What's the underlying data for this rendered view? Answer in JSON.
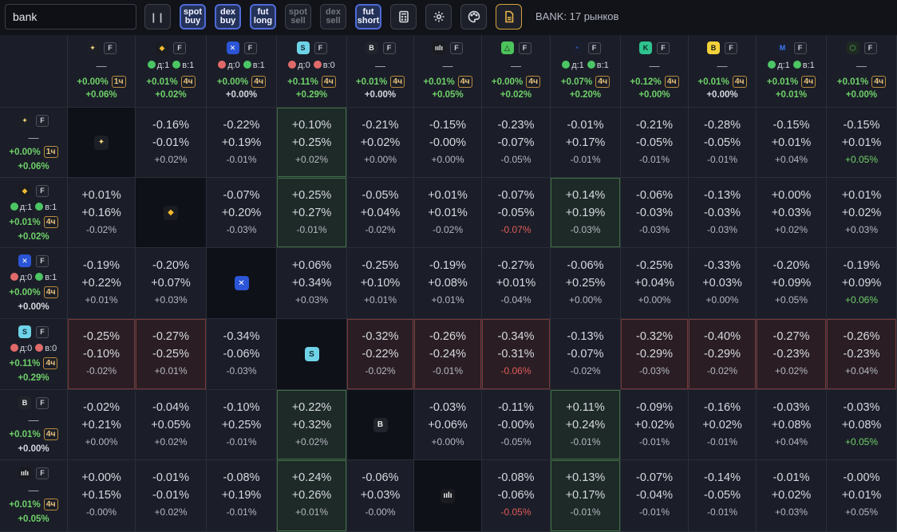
{
  "search": {
    "value": "bank"
  },
  "toolbar": {
    "pause_label": "| |",
    "buttons": [
      {
        "l1": "spot",
        "l2": "buy",
        "state": "on"
      },
      {
        "l1": "dex",
        "l2": "buy",
        "state": "on"
      },
      {
        "l1": "fut",
        "l2": "long",
        "state": "on"
      },
      {
        "l1": "spot",
        "l2": "sell",
        "state": "off"
      },
      {
        "l1": "dex",
        "l2": "sell",
        "state": "off"
      },
      {
        "l1": "fut",
        "l2": "short",
        "state": "on"
      }
    ],
    "icons": [
      "calculator-icon",
      "gear-icon",
      "palette-icon",
      "document-icon"
    ]
  },
  "status": "BANK: 17 рынков",
  "fut_badge": "F",
  "exchanges": [
    {
      "id": "gate",
      "bg": "#1d1f26",
      "fg": "#f0d27a",
      "glyph": "✦",
      "mid": "dash",
      "d": "",
      "w": "",
      "p1": "+0.00%",
      "tf": "1ч",
      "p2": "+0.06%",
      "p2n": false
    },
    {
      "id": "binance",
      "bg": "#1b1c22",
      "fg": "#f3ba2f",
      "glyph": "◆",
      "mid": "dw",
      "d": "д:1",
      "dc": "g",
      "w": "в:1",
      "wc": "g",
      "p1": "+0.01%",
      "tf": "4ч",
      "p2": "+0.02%",
      "p2n": false
    },
    {
      "id": "mexc",
      "bg": "#2b55d6",
      "fg": "#ffffff",
      "glyph": "✕",
      "mid": "dw",
      "d": "д:0",
      "dc": "r",
      "w": "в:1",
      "wc": "g",
      "p1": "+0.00%",
      "tf": "4ч",
      "p2": "+0.00%",
      "p2n": true
    },
    {
      "id": "bybit",
      "bg": "#6fd3e8",
      "fg": "#0f2a33",
      "glyph": "S",
      "mid": "dw",
      "d": "д:0",
      "dc": "r",
      "w": "в:0",
      "wc": "r",
      "p1": "+0.11%",
      "tf": "4ч",
      "p2": "+0.29%",
      "p2n": false
    },
    {
      "id": "bitget",
      "bg": "#22242c",
      "fg": "#e8e8e8",
      "glyph": "B",
      "mid": "dash",
      "d": "",
      "w": "",
      "p1": "+0.01%",
      "tf": "4ч",
      "p2": "+0.00%",
      "p2n": true
    },
    {
      "id": "kucoin",
      "bg": "#1a1b20",
      "fg": "#f2f2f2",
      "glyph": "ıılı",
      "mid": "dash",
      "d": "",
      "w": "",
      "p1": "+0.01%",
      "tf": "4ч",
      "p2": "+0.05%",
      "p2n": false
    },
    {
      "id": "okx",
      "bg": "#4cc35b",
      "fg": "#0d1a0f",
      "glyph": "△",
      "mid": "dash",
      "d": "",
      "w": "",
      "p1": "+0.00%",
      "tf": "4ч",
      "p2": "+0.02%",
      "p2n": false
    },
    {
      "id": "htx",
      "bg": "#1a1e2d",
      "fg": "#3a6df0",
      "glyph": "◔",
      "mid": "dw",
      "d": "д:1",
      "dc": "g",
      "w": "в:1",
      "wc": "g",
      "p1": "+0.07%",
      "tf": "4ч",
      "p2": "+0.20%",
      "p2n": false
    },
    {
      "id": "kcex",
      "bg": "#2fc38f",
      "fg": "#0c2a20",
      "glyph": "K",
      "mid": "dash",
      "d": "",
      "w": "",
      "p1": "+0.12%",
      "tf": "4ч",
      "p2": "+0.00%",
      "p2n": false
    },
    {
      "id": "bingx",
      "bg": "#f3d13a",
      "fg": "#1b1b1b",
      "glyph": "B",
      "mid": "dash",
      "d": "",
      "w": "",
      "p1": "+0.01%",
      "tf": "4ч",
      "p2": "+0.00%",
      "p2n": true
    },
    {
      "id": "lbank",
      "bg": "#1a1e2d",
      "fg": "#3a7bf5",
      "glyph": "M",
      "mid": "dw",
      "d": "д:1",
      "dc": "g",
      "w": "в:1",
      "wc": "g",
      "p1": "+0.01%",
      "tf": "4ч",
      "p2": "+0.01%",
      "p2n": false
    },
    {
      "id": "ourbit",
      "bg": "#1f2a22",
      "fg": "#59c05c",
      "glyph": "⬡",
      "mid": "dash",
      "d": "",
      "w": "",
      "p1": "+0.01%",
      "tf": "4ч",
      "p2": "+0.00%",
      "p2n": false
    }
  ],
  "rows": [
    {
      "cells": [
        null,
        [
          "-0.16%",
          "-0.01%",
          "+0.02%",
          ""
        ],
        [
          "-0.22%",
          "+0.19%",
          "-0.01%",
          ""
        ],
        [
          "+0.10%",
          "+0.25%",
          "+0.02%",
          "",
          1
        ],
        [
          "-0.21%",
          "+0.02%",
          "+0.00%",
          ""
        ],
        [
          "-0.15%",
          "-0.00%",
          "+0.00%",
          ""
        ],
        [
          "-0.23%",
          "-0.07%",
          "-0.05%",
          ""
        ],
        [
          "-0.01%",
          "+0.17%",
          "-0.01%",
          ""
        ],
        [
          "-0.21%",
          "-0.05%",
          "-0.01%",
          ""
        ],
        [
          "-0.28%",
          "-0.05%",
          "-0.01%",
          ""
        ],
        [
          "-0.15%",
          "+0.01%",
          "+0.04%",
          ""
        ],
        [
          "-0.15%",
          "+0.01%",
          "+0.05%",
          "pos"
        ]
      ]
    },
    {
      "cells": [
        [
          "+0.01%",
          "+0.16%",
          "-0.02%",
          ""
        ],
        null,
        [
          "-0.07%",
          "+0.20%",
          "-0.03%",
          ""
        ],
        [
          "+0.25%",
          "+0.27%",
          "-0.01%",
          "",
          1
        ],
        [
          "-0.05%",
          "+0.04%",
          "-0.02%",
          ""
        ],
        [
          "+0.01%",
          "+0.01%",
          "-0.02%",
          ""
        ],
        [
          "-0.07%",
          "-0.05%",
          "-0.07%",
          "neg"
        ],
        [
          "+0.14%",
          "+0.19%",
          "-0.03%",
          "",
          1
        ],
        [
          "-0.06%",
          "-0.03%",
          "-0.03%",
          ""
        ],
        [
          "-0.13%",
          "-0.03%",
          "-0.03%",
          ""
        ],
        [
          "+0.00%",
          "+0.03%",
          "+0.02%",
          ""
        ],
        [
          "+0.01%",
          "+0.02%",
          "+0.03%",
          ""
        ]
      ]
    },
    {
      "cells": [
        [
          "-0.19%",
          "+0.22%",
          "+0.01%",
          ""
        ],
        [
          "-0.20%",
          "+0.07%",
          "+0.03%",
          ""
        ],
        null,
        [
          "+0.06%",
          "+0.34%",
          "+0.03%",
          ""
        ],
        [
          "-0.25%",
          "+0.10%",
          "+0.01%",
          ""
        ],
        [
          "-0.19%",
          "+0.08%",
          "+0.01%",
          ""
        ],
        [
          "-0.27%",
          "+0.01%",
          "-0.04%",
          ""
        ],
        [
          "-0.06%",
          "+0.25%",
          "+0.00%",
          ""
        ],
        [
          "-0.25%",
          "+0.04%",
          "+0.00%",
          ""
        ],
        [
          "-0.33%",
          "+0.03%",
          "+0.00%",
          ""
        ],
        [
          "-0.20%",
          "+0.09%",
          "+0.05%",
          ""
        ],
        [
          "-0.19%",
          "+0.09%",
          "+0.06%",
          "pos"
        ]
      ]
    },
    {
      "cells": [
        [
          "-0.25%",
          "-0.10%",
          "-0.02%",
          "",
          2
        ],
        [
          "-0.27%",
          "-0.25%",
          "+0.01%",
          "",
          2
        ],
        [
          "-0.34%",
          "-0.06%",
          "-0.03%",
          ""
        ],
        null,
        [
          "-0.32%",
          "-0.22%",
          "-0.02%",
          "",
          2
        ],
        [
          "-0.26%",
          "-0.24%",
          "-0.01%",
          "",
          2
        ],
        [
          "-0.34%",
          "-0.31%",
          "-0.06%",
          "neg",
          2
        ],
        [
          "-0.13%",
          "-0.07%",
          "-0.02%",
          ""
        ],
        [
          "-0.32%",
          "-0.29%",
          "-0.03%",
          "",
          2
        ],
        [
          "-0.40%",
          "-0.29%",
          "-0.02%",
          "",
          2
        ],
        [
          "-0.27%",
          "-0.23%",
          "+0.02%",
          "",
          2
        ],
        [
          "-0.26%",
          "-0.23%",
          "+0.04%",
          "",
          2
        ]
      ]
    },
    {
      "cells": [
        [
          "-0.02%",
          "+0.21%",
          "+0.00%",
          ""
        ],
        [
          "-0.04%",
          "+0.05%",
          "+0.02%",
          ""
        ],
        [
          "-0.10%",
          "+0.25%",
          "-0.01%",
          ""
        ],
        [
          "+0.22%",
          "+0.32%",
          "+0.02%",
          "",
          1
        ],
        null,
        [
          "-0.03%",
          "+0.06%",
          "+0.00%",
          ""
        ],
        [
          "-0.11%",
          "-0.00%",
          "-0.05%",
          ""
        ],
        [
          "+0.11%",
          "+0.24%",
          "-0.01%",
          "",
          1
        ],
        [
          "-0.09%",
          "+0.02%",
          "-0.01%",
          ""
        ],
        [
          "-0.16%",
          "+0.02%",
          "-0.01%",
          ""
        ],
        [
          "-0.03%",
          "+0.08%",
          "+0.04%",
          ""
        ],
        [
          "-0.03%",
          "+0.08%",
          "+0.05%",
          "pos"
        ]
      ]
    },
    {
      "cells": [
        [
          "+0.00%",
          "+0.15%",
          "-0.00%",
          ""
        ],
        [
          "-0.01%",
          "-0.01%",
          "+0.02%",
          ""
        ],
        [
          "-0.08%",
          "+0.19%",
          "-0.01%",
          ""
        ],
        [
          "+0.24%",
          "+0.26%",
          "+0.01%",
          "",
          1
        ],
        [
          "-0.06%",
          "+0.03%",
          "-0.00%",
          ""
        ],
        null,
        [
          "-0.08%",
          "-0.06%",
          "-0.05%",
          "neg"
        ],
        [
          "+0.13%",
          "+0.17%",
          "-0.01%",
          "",
          1
        ],
        [
          "-0.07%",
          "-0.04%",
          "-0.01%",
          ""
        ],
        [
          "-0.14%",
          "-0.05%",
          "-0.01%",
          ""
        ],
        [
          "-0.01%",
          "+0.02%",
          "+0.03%",
          ""
        ],
        [
          "-0.00%",
          "+0.01%",
          "+0.05%",
          ""
        ]
      ]
    }
  ]
}
